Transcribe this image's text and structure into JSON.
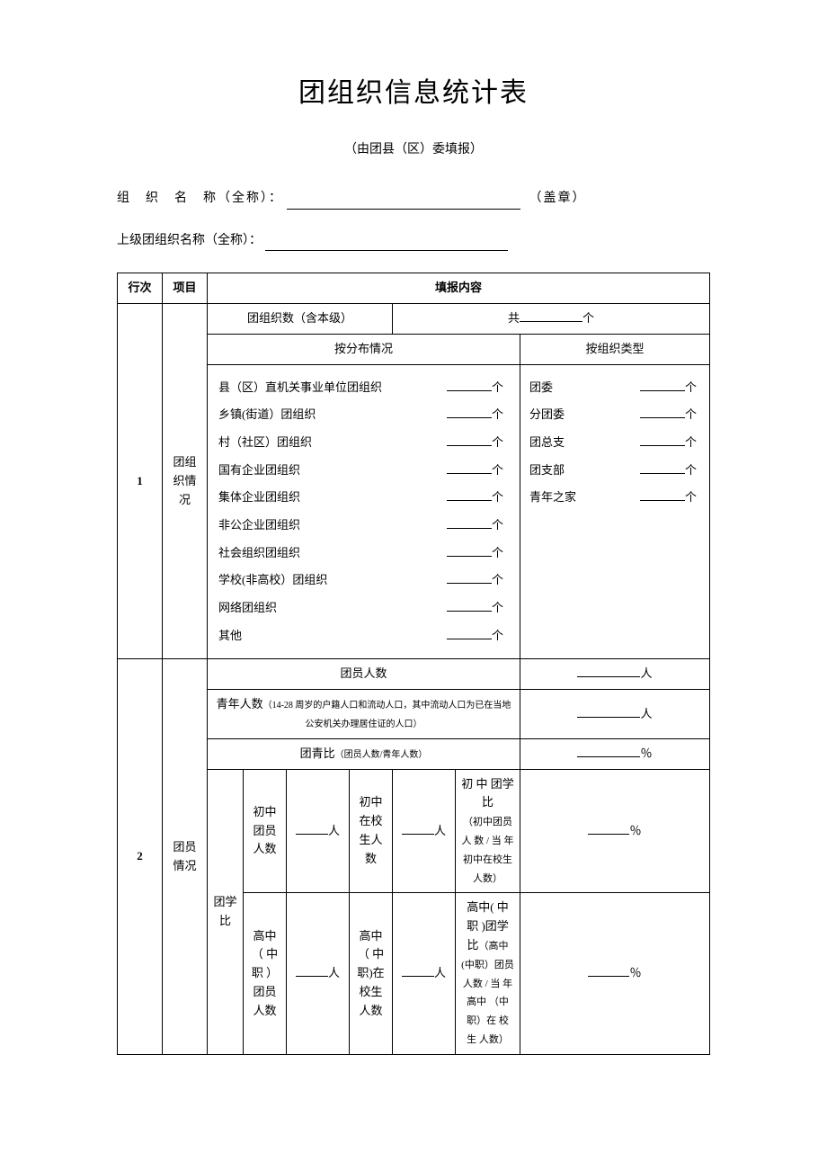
{
  "title": "团组织信息统计表",
  "subtitle": "（由团县（区）委填报）",
  "meta": {
    "org_name_label": "组　织　名　称（全称）：",
    "org_name_suffix": "（盖章）",
    "parent_org_label": "上级团组织名称（全称）："
  },
  "header": {
    "row_num": "行次",
    "project": "项目",
    "content": "填报内容"
  },
  "row1": {
    "num": "1",
    "project": "团组织情况",
    "org_count_label": "团组织数（含本级）",
    "org_count_prefix": "共",
    "org_count_suffix": "个",
    "by_dist": "按分布情况",
    "by_type": "按组织类型",
    "dist_items": [
      "县（区）直机关事业单位团组织",
      "乡镇(街道）团组织",
      "村（社区）团组织",
      "国有企业团组织",
      "集体企业团组织",
      "非公企业团组织",
      "社会组织团组织",
      "学校(非高校）团组织",
      "网络团组织",
      "其他"
    ],
    "type_items": [
      "团委",
      "分团委",
      "团总支",
      "团支部",
      "青年之家"
    ],
    "unit_ge": "个"
  },
  "row2": {
    "num": "2",
    "project": "团员情况",
    "member_count": "团员人数",
    "youth_count_label": "青年人数",
    "youth_count_note": "（14-28 周岁的户籍人口和流动人口，其中流动人口为已在当地公安机关办理居住证的人口）",
    "ratio_label": "团青比",
    "ratio_note": "（团员人数/青年人数）",
    "unit_person": "人",
    "unit_percent": "％",
    "school_ratio": "团学比",
    "jr_member": "初中团员人数",
    "jr_student": "初中在校生人数",
    "jr_ratio_label": "初 中 团学 比",
    "jr_ratio_note": "（初中团员人 数 / 当 年初中在校生人数）",
    "sr_member": "高中（ 中职 ）团员 人数",
    "sr_student": "高中（ 中职)在 校生 人数",
    "sr_ratio_label": "高中( 中职 )团学比",
    "sr_ratio_note": "（高中(中职）团员人数 / 当 年 高中 （中职）在 校 生 人数）"
  }
}
